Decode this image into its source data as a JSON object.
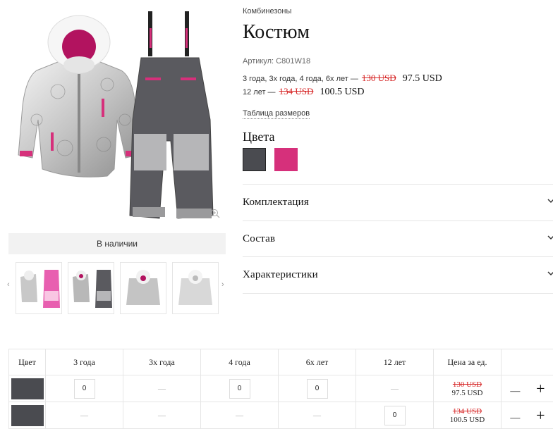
{
  "product": {
    "category": "Комбинезоны",
    "title": "Костюм",
    "sku_label": "Артикул:",
    "sku": "C801W18",
    "price_lines": [
      {
        "sizes": "3 года, 3х года, 4 года, 6х лет —",
        "old_price": "130 USD",
        "new_price": "97.5 USD"
      },
      {
        "sizes": "12 лет —",
        "old_price": "134 USD",
        "new_price": "100.5 USD"
      }
    ],
    "size_table_link": "Таблица размеров",
    "colors_title": "Цвета",
    "colors": [
      {
        "name": "dark-grey",
        "hex": "#4a4b50"
      },
      {
        "name": "pink",
        "hex": "#d6307b"
      }
    ],
    "availability": "В наличии",
    "thumbs_prev": "‹",
    "thumbs_next": "›"
  },
  "accordion": [
    {
      "label": "Комплектация"
    },
    {
      "label": "Состав"
    },
    {
      "label": "Характеристики"
    }
  ],
  "order_table": {
    "headers": [
      "Цвет",
      "3 года",
      "3х года",
      "4 года",
      "6х лет",
      "12 лет",
      "Цена за ед.",
      ""
    ],
    "rows": [
      {
        "color_hex": "#4a4b50",
        "cells": [
          "0",
          "—",
          "0",
          "0",
          "—"
        ],
        "old_price": "130 USD",
        "new_price": "97.5 USD",
        "minus": "—",
        "plus": "+"
      },
      {
        "color_hex": "#4a4b50",
        "cells": [
          "—",
          "—",
          "—",
          "—",
          "0"
        ],
        "old_price": "134 USD",
        "new_price": "100.5 USD",
        "minus": "—",
        "plus": "+"
      }
    ]
  },
  "colors": {
    "sale_red": "#d62525",
    "accent_pink": "#d6307b",
    "garment_dark": "#5a5a5f",
    "border": "#e6e6e6"
  }
}
